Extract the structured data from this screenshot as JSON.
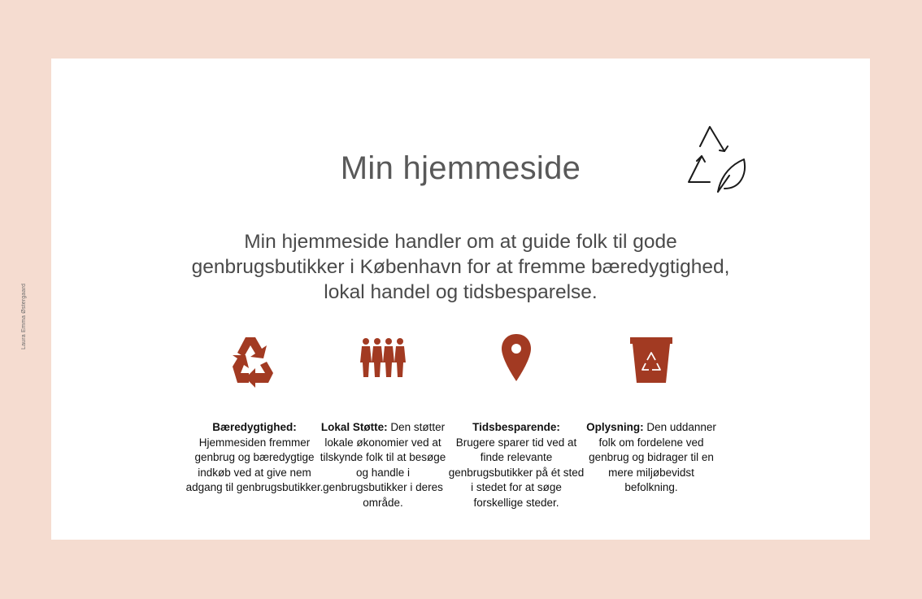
{
  "author": "Laura Emma Østergaard",
  "title": "Min hjemmeside",
  "intro_lines": [
    "Min hjemmeside handler om at guide folk til gode",
    "genbrugsbutikker i København for at fremme bæredygtighed,",
    "lokal handel og tidsbesparelse."
  ],
  "colors": {
    "background": "#f5dcd0",
    "accent": "#a23a22"
  },
  "icons": {
    "top": "recycle-leaf-icon"
  },
  "features": [
    {
      "icon": "recycle-icon",
      "heading": "Bæredygtighed:",
      "body": "Hjemmesiden fremmer genbrug og bæredygtige indkøb ved at give nem adgang til genbrugsbutikker."
    },
    {
      "icon": "people-group-icon",
      "heading": "Lokal Støtte:",
      "body": "Den støtter lokale økonomier ved at tilskynde folk til at besøge og handle i genbrugsbutikker i deres område."
    },
    {
      "icon": "map-pin-icon",
      "heading": "Tidsbesparende:",
      "body": "Brugere sparer tid ved at finde relevante genbrugsbutikker på ét sted i stedet for at søge forskellige steder."
    },
    {
      "icon": "recycle-bin-icon",
      "heading": "Oplysning:",
      "body": "Den uddanner folk om fordelene ved genbrug og bidrager til en mere miljøbevidst befolkning."
    }
  ]
}
